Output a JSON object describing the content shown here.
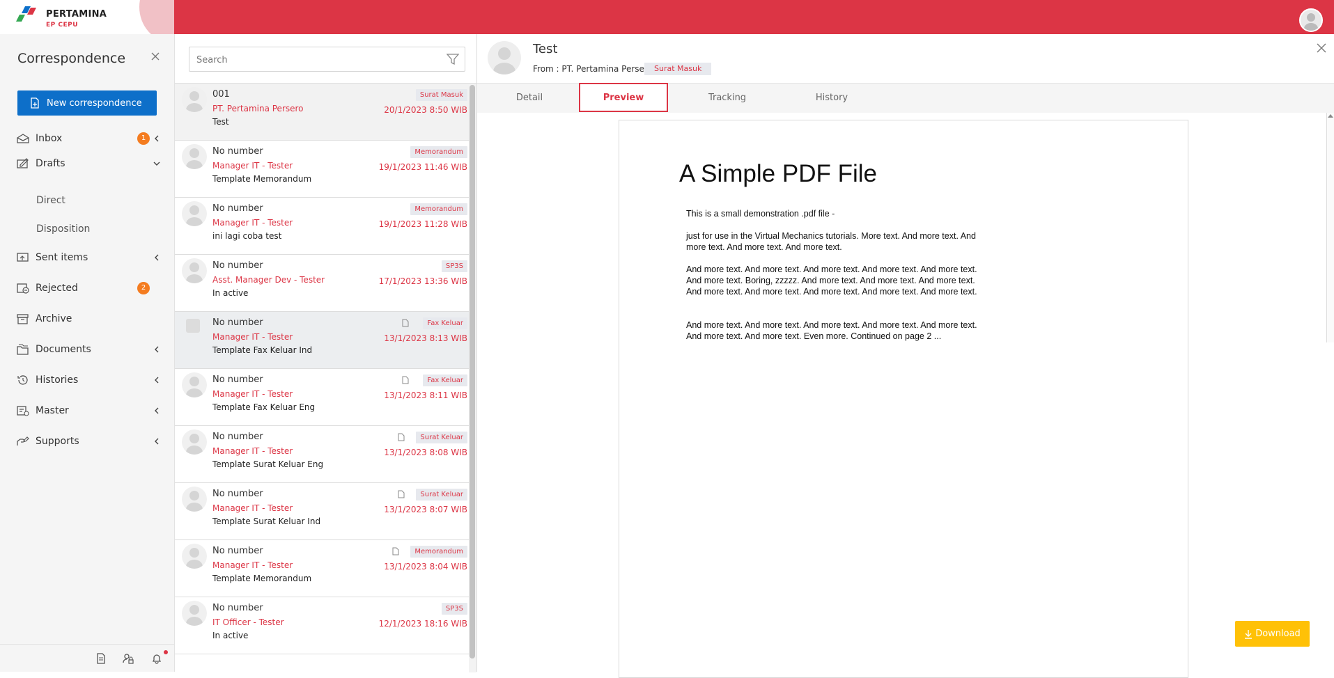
{
  "brand": {
    "name": "PERTAMINA",
    "sub": "EP CEPU"
  },
  "sidebar": {
    "title": "Correspondence",
    "new_button": "New correspondence",
    "items": [
      {
        "label": "Inbox",
        "icon": "inbox-icon",
        "badge": "1"
      },
      {
        "label": "Drafts",
        "icon": "drafts-icon"
      },
      {
        "label": "Direct"
      },
      {
        "label": "Disposition"
      },
      {
        "label": "Sent items",
        "icon": "sent-icon"
      },
      {
        "label": "Rejected",
        "icon": "rejected-icon",
        "badge": "2"
      },
      {
        "label": "Archive",
        "icon": "archive-icon"
      },
      {
        "label": "Documents",
        "icon": "documents-icon"
      },
      {
        "label": "Histories",
        "icon": "history-icon"
      },
      {
        "label": "Master",
        "icon": "master-icon"
      },
      {
        "label": "Supports",
        "icon": "supports-icon"
      }
    ]
  },
  "search": {
    "placeholder": "Search"
  },
  "list": [
    {
      "number": "001",
      "from": "PT. Pertamina Persero",
      "subject": "Test",
      "tag": "Surat Masuk",
      "date": "20/1/2023 8:50 WIB"
    },
    {
      "number": "No number",
      "from": "Manager IT - Tester",
      "subject": "Template Memorandum",
      "tag": "Memorandum",
      "date": "19/1/2023 11:46 WIB"
    },
    {
      "number": "No number",
      "from": "Manager IT - Tester",
      "subject": "ini lagi coba test",
      "tag": "Memorandum",
      "date": "19/1/2023 11:28 WIB"
    },
    {
      "number": "No number",
      "from": "Asst. Manager Dev - Tester",
      "subject": "In active",
      "tag": "SP3S",
      "date": "17/1/2023 13:36 WIB"
    },
    {
      "number": "No number",
      "from": "Manager IT - Tester",
      "subject": "Template Fax Keluar Ind",
      "tag": "Fax Keluar",
      "date": "13/1/2023 8:13 WIB"
    },
    {
      "number": "No number",
      "from": "Manager IT - Tester",
      "subject": "Template Fax Keluar Eng",
      "tag": "Fax Keluar",
      "date": "13/1/2023 8:11 WIB"
    },
    {
      "number": "No number",
      "from": "Manager IT - Tester",
      "subject": "Template Surat Keluar Eng",
      "tag": "Surat Keluar",
      "date": "13/1/2023 8:08 WIB"
    },
    {
      "number": "No number",
      "from": "Manager IT - Tester",
      "subject": "Template Surat Keluar Ind",
      "tag": "Surat Keluar",
      "date": "13/1/2023 8:07 WIB"
    },
    {
      "number": "No number",
      "from": "Manager IT - Tester",
      "subject": "Template Memorandum",
      "tag": "Memorandum",
      "date": "13/1/2023 8:04 WIB"
    },
    {
      "number": "No number",
      "from": "IT Officer - Tester",
      "subject": "In active",
      "tag": "SP3S",
      "date": "12/1/2023 18:16 WIB"
    }
  ],
  "detail": {
    "title": "Test",
    "from": "From : PT. Pertamina Persero",
    "tag": "Surat Masuk",
    "tabs": [
      "Detail",
      "Preview",
      "Tracking",
      "History"
    ],
    "active_tab": "Preview",
    "pdf": {
      "title": "A Simple PDF File",
      "p1": "This is a small demonstration .pdf file -",
      "p2": "just for use in the Virtual Mechanics tutorials. More text. And more text. And more text. And more text. And more text.",
      "p3": "And more text. And more text. And more text. And more text. And more text. And more text. Boring, zzzzz. And more text. And more text. And more text. And more text. And more text. And more text. And more text. And more text.",
      "p4": "And more text. And more text. And more text. And more text. And more text. And more text. And more text. Even more. Continued on page 2 ..."
    },
    "download": "Download"
  }
}
